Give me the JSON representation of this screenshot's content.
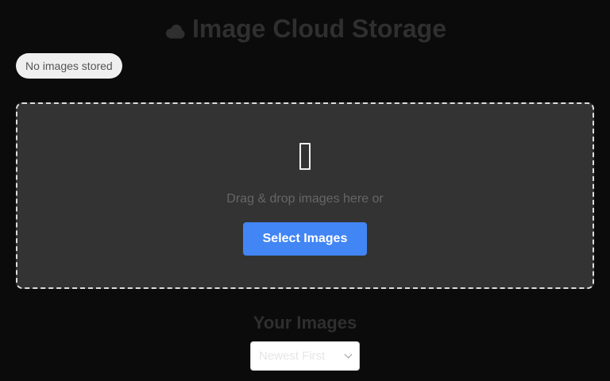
{
  "header": {
    "icon": "cloud-icon",
    "title": "Image Cloud Storage"
  },
  "status": {
    "text": "No images stored"
  },
  "dropzone": {
    "icon": "upload-icon",
    "prompt": "Drag & drop images here or",
    "button_label": "Select Images"
  },
  "gallery": {
    "title": "Your Images",
    "sort": {
      "selected": "Newest First"
    }
  },
  "colors": {
    "background": "#0b0b0b",
    "dropzone": "#333333",
    "accent": "#4285f4"
  }
}
